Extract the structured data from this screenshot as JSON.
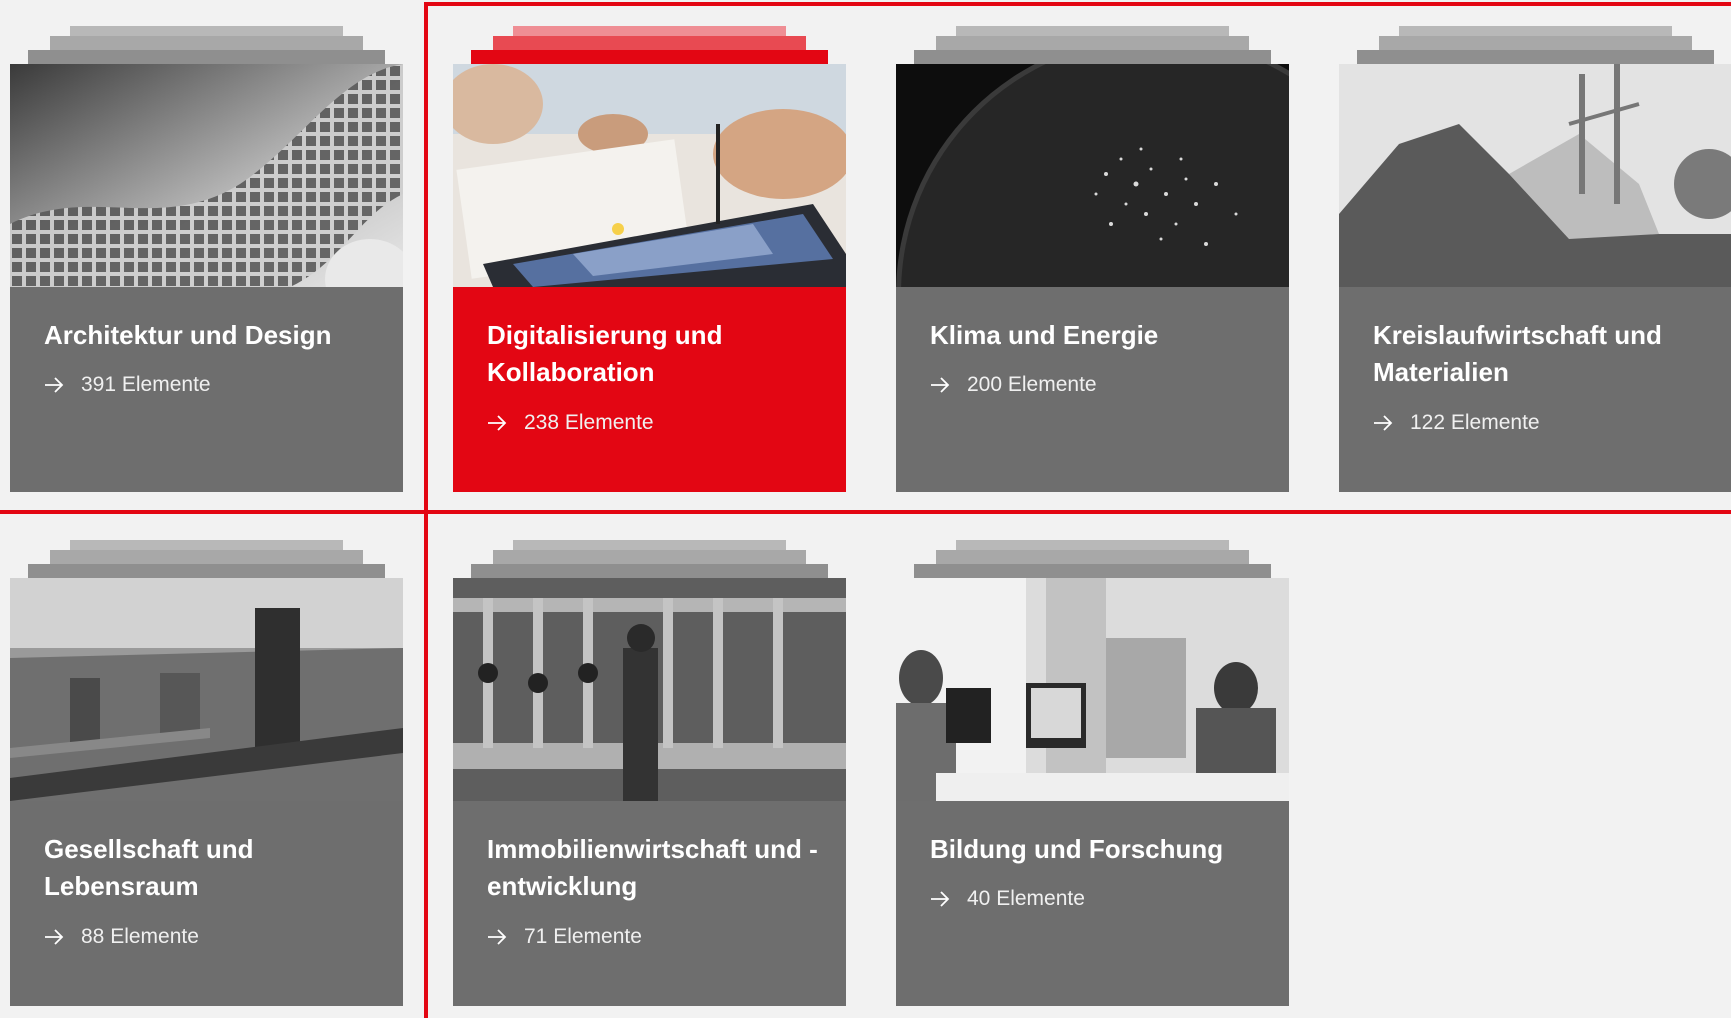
{
  "colors": {
    "accent": "#e30613",
    "card_body": "#6e6e6e",
    "background": "#f2f2f2"
  },
  "cards": [
    {
      "title": "Architektur und Design",
      "count": "391 Elemente",
      "image": "parametric-architecture-photo",
      "active": false
    },
    {
      "title": "Digitalisierung und Kollaboration",
      "count": "238 Elemente",
      "image": "tablet-planning-photo",
      "active": true
    },
    {
      "title": "Klima und Energie",
      "count": "200 Elemente",
      "image": "earth-night-lights-photo",
      "active": false
    },
    {
      "title": "Kreislaufwirtschaft und Materialien",
      "count": "122 Elemente",
      "image": "brick-demolition-photo",
      "active": false
    },
    {
      "title": "Gesellschaft und Lebensraum",
      "count": "88 Elemente",
      "image": "city-skyline-photo",
      "active": false
    },
    {
      "title": "Immobilienwirtschaft und -entwicklung",
      "count": "71 Elemente",
      "image": "industrial-pipes-photo",
      "active": false
    },
    {
      "title": "Bildung und Forschung",
      "count": "40 Elemente",
      "image": "office-team-photo",
      "active": false
    }
  ]
}
